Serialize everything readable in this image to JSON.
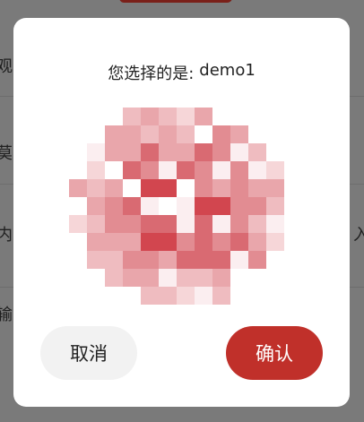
{
  "background_form": {
    "row_labels": [
      "观",
      "莫",
      "内",
      "输"
    ],
    "right_fragment": "入"
  },
  "modal": {
    "prompt": "您选择的是:",
    "selected_value": "demo1",
    "cancel_label": "取消",
    "confirm_label": "确认"
  },
  "colors": {
    "confirm": "#c0302a",
    "cancel_bg": "#f2f2f2",
    "overlay": "#7a7a7a"
  },
  "icons": {
    "preview": "pixelated-image-icon"
  }
}
